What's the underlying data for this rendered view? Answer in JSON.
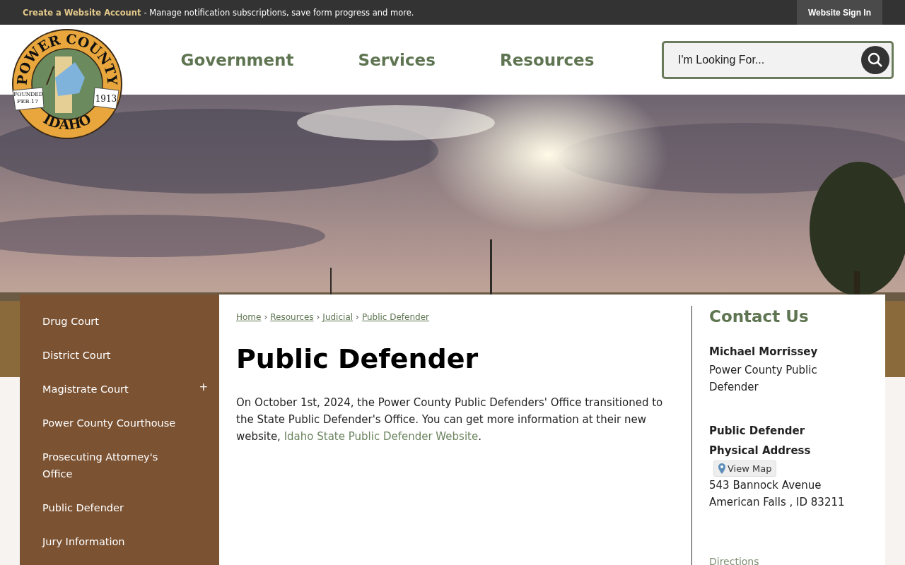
{
  "top_bar": {
    "account_link": "Create a Website Account",
    "account_text": "- Manage notification subscriptions, save form progress and more.",
    "sign_in": "Website Sign In"
  },
  "logo": {
    "top": "POWER COUNTY",
    "bottom": "IDAHO",
    "founded": "FOUNDED",
    "date": "FEB.17",
    "year": "1913"
  },
  "nav": [
    "Government",
    "Services",
    "Resources"
  ],
  "search": {
    "placeholder": "I'm Looking For..."
  },
  "hero": {
    "kind": "picture"
  },
  "sidebar": {
    "items": [
      {
        "label": "Drug Court"
      },
      {
        "label": "District Court"
      },
      {
        "label": "Magistrate Court",
        "toggle": "+"
      },
      {
        "label": "Power County Courthouse"
      },
      {
        "label": "Prosecuting Attorney's Office"
      },
      {
        "label": "Public Defender"
      },
      {
        "label": "Jury Information"
      }
    ]
  },
  "breadcrumb": [
    "Home",
    "Resources",
    "Judicial",
    "Public Defender"
  ],
  "breadcrumb_separator": "›",
  "title": "Public Defender",
  "body": {
    "text": "On October 1st, 2024, the Power County Public Defenders' Office transitioned to the State Public Defender's Office. You can get more information at their new website,",
    "link": "Idaho State Public Defender Website",
    "end": "."
  },
  "contact": {
    "heading": "Contact Us",
    "name": "Michael Morrissey",
    "role": "Power County Public Defender",
    "address_title": [
      "Public Defender",
      "Physical Address"
    ],
    "map_button": "View Map",
    "address": [
      "543 Bannock Avenue",
      "American Falls , ID 83211"
    ],
    "directions": "Directions"
  }
}
